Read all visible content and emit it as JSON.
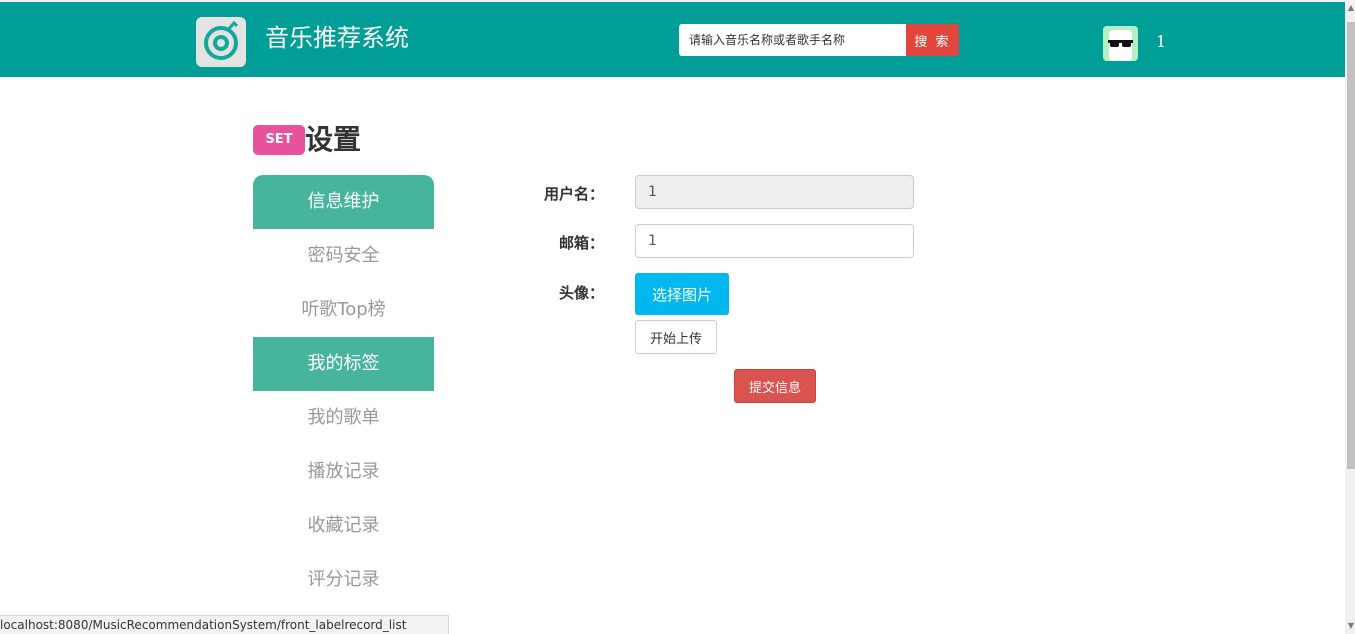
{
  "header": {
    "brand": "音乐推荐系统",
    "search_placeholder": "请输入音乐名称或者歌手名称",
    "search_button": "搜 索",
    "username": "1",
    "logo_icon": "music-disc-icon",
    "avatar_icon": "sunglasses-avatar-icon",
    "bg_color": "#009e96",
    "search_button_color": "#e0463b"
  },
  "page": {
    "badge": "SET",
    "title": "设置"
  },
  "sidebar": {
    "items": [
      {
        "label": "信息维护",
        "active": true
      },
      {
        "label": "密码安全",
        "active": false
      },
      {
        "label": "听歌Top榜",
        "active": false
      },
      {
        "label": "我的标签",
        "active": true
      },
      {
        "label": "我的歌单",
        "active": false
      },
      {
        "label": "播放记录",
        "active": false
      },
      {
        "label": "收藏记录",
        "active": false
      },
      {
        "label": "评分记录",
        "active": false
      }
    ],
    "active_color": "#47b49c"
  },
  "form": {
    "username_label": "用户名：",
    "username_value": "1",
    "email_label": "邮箱：",
    "email_value": "1",
    "avatar_label": "头像：",
    "pick_button": "选择图片",
    "upload_button": "开始上传",
    "submit_button": "提交信息"
  },
  "status_bar": {
    "url": "localhost:8080/MusicRecommendationSystem/front_labelrecord_list"
  }
}
